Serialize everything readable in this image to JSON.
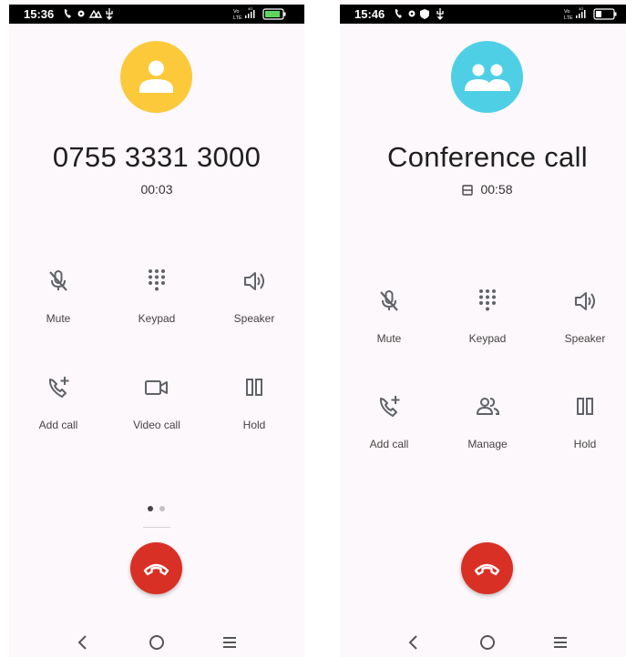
{
  "left": {
    "status": {
      "time": "15:36"
    },
    "avatar_color": "#fbc93a",
    "title": "0755 3331 3000",
    "timer": "00:03",
    "controls": {
      "mute": "Mute",
      "keypad": "Keypad",
      "speaker": "Speaker",
      "add_call": "Add call",
      "video_call": "Video call",
      "hold": "Hold"
    },
    "pager": {
      "active": 1,
      "count": 2
    }
  },
  "right": {
    "status": {
      "time": "15:46"
    },
    "avatar_color": "#4fcfe6",
    "title": "Conference call",
    "timer": "00:58",
    "controls": {
      "mute": "Mute",
      "keypad": "Keypad",
      "speaker": "Speaker",
      "add_call": "Add call",
      "manage": "Manage",
      "hold": "Hold"
    }
  },
  "colors": {
    "end_call": "#d93025",
    "icon_gray": "#5f6368",
    "background": "#fdf8fb"
  },
  "icons": [
    "mic-off-icon",
    "dialpad-icon",
    "speaker-icon",
    "add-call-icon",
    "video-call-icon",
    "manage-people-icon",
    "pause-icon",
    "call-end-icon",
    "back-icon",
    "home-icon",
    "menu-icon"
  ]
}
